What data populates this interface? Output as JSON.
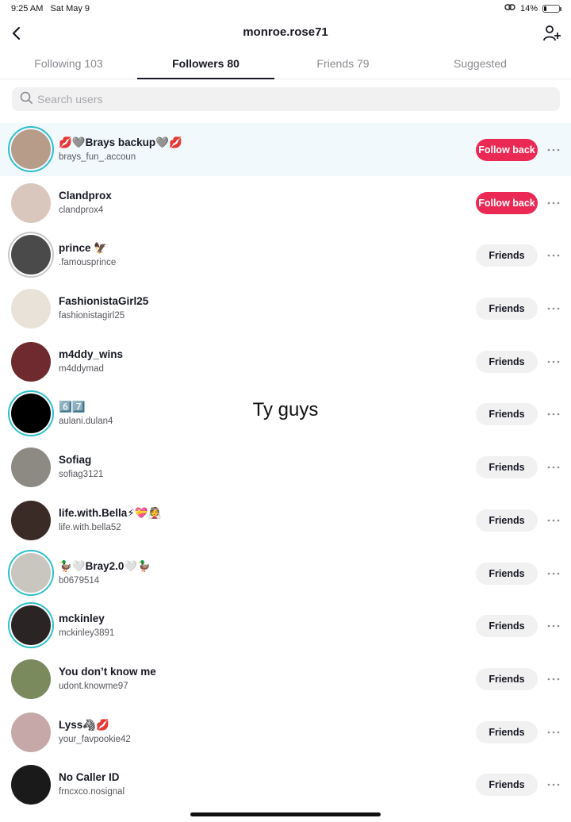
{
  "status_bar": {
    "time": "9:25 AM",
    "date": "Sat May 9",
    "battery": "14%",
    "battery_level": 0.14
  },
  "header": {
    "title": "monroe.rose71",
    "back_icon": "chevron-left-icon",
    "add_icon": "add-user-icon"
  },
  "tabs": [
    {
      "label": "Following 103",
      "active": false
    },
    {
      "label": "Followers 80",
      "active": true
    },
    {
      "label": "Friends 79",
      "active": false
    },
    {
      "label": "Suggested",
      "active": false
    }
  ],
  "search": {
    "placeholder": "Search users",
    "value": ""
  },
  "overlay": {
    "text": "Ty guys"
  },
  "colors": {
    "accent": "#ea2a55",
    "ring": "#2ebfc9",
    "highlight": "#f2f9fd"
  },
  "users": [
    {
      "name": "💋🩶Brays backup🩶💋",
      "handle": "brays_fun_.accoun",
      "button": "Follow back",
      "type": "follow",
      "ring": "teal",
      "highlight": true,
      "avatar_color": "#b89c8a"
    },
    {
      "name": "Clandprox",
      "handle": "clandprox4",
      "button": "Follow back",
      "type": "follow",
      "ring": "none",
      "highlight": false,
      "avatar_color": "#d9c7bd"
    },
    {
      "name": "prince 🦅",
      "handle": ".famousprince",
      "button": "Friends",
      "type": "friends",
      "ring": "gray",
      "highlight": false,
      "avatar_color": "#4a4a4a"
    },
    {
      "name": "FashionistaGirl25",
      "handle": "fashionistagirl25",
      "button": "Friends",
      "type": "friends",
      "ring": "none",
      "highlight": false,
      "avatar_color": "#e9e2d8"
    },
    {
      "name": "m4ddy_wins",
      "handle": "m4ddymad",
      "button": "Friends",
      "type": "friends",
      "ring": "none",
      "highlight": false,
      "avatar_color": "#6e2a2e"
    },
    {
      "name": "6️⃣7️⃣",
      "handle": "aulani.dulan4",
      "button": "Friends",
      "type": "friends",
      "ring": "teal",
      "highlight": false,
      "avatar_color": "#000000"
    },
    {
      "name": "Sofiag",
      "handle": "sofiag3121",
      "button": "Friends",
      "type": "friends",
      "ring": "none",
      "highlight": false,
      "avatar_color": "#8d8a84"
    },
    {
      "name": "life.with.Bella⚡💝👰",
      "handle": "life.with.bella52",
      "button": "Friends",
      "type": "friends",
      "ring": "none",
      "highlight": false,
      "avatar_color": "#3b2b26"
    },
    {
      "name": "🦆🤍Bray2.0🤍🦆",
      "handle": "b0679514",
      "button": "Friends",
      "type": "friends",
      "ring": "teal",
      "highlight": false,
      "avatar_color": "#c9c6c0"
    },
    {
      "name": "mckinley",
      "handle": "mckinley3891",
      "button": "Friends",
      "type": "friends",
      "ring": "teal",
      "highlight": false,
      "avatar_color": "#2a2424"
    },
    {
      "name": "You don’t know me",
      "handle": "udont.knowme97",
      "button": "Friends",
      "type": "friends",
      "ring": "none",
      "highlight": false,
      "avatar_color": "#7a8a5c"
    },
    {
      "name": "Lyss🦓💋",
      "handle": "your_favpookie42",
      "button": "Friends",
      "type": "friends",
      "ring": "none",
      "highlight": false,
      "avatar_color": "#c7a8a8"
    },
    {
      "name": "No Caller ID",
      "handle": "frncxco.nosignal",
      "button": "Friends",
      "type": "friends",
      "ring": "none",
      "highlight": false,
      "avatar_color": "#1a1a1a"
    }
  ]
}
